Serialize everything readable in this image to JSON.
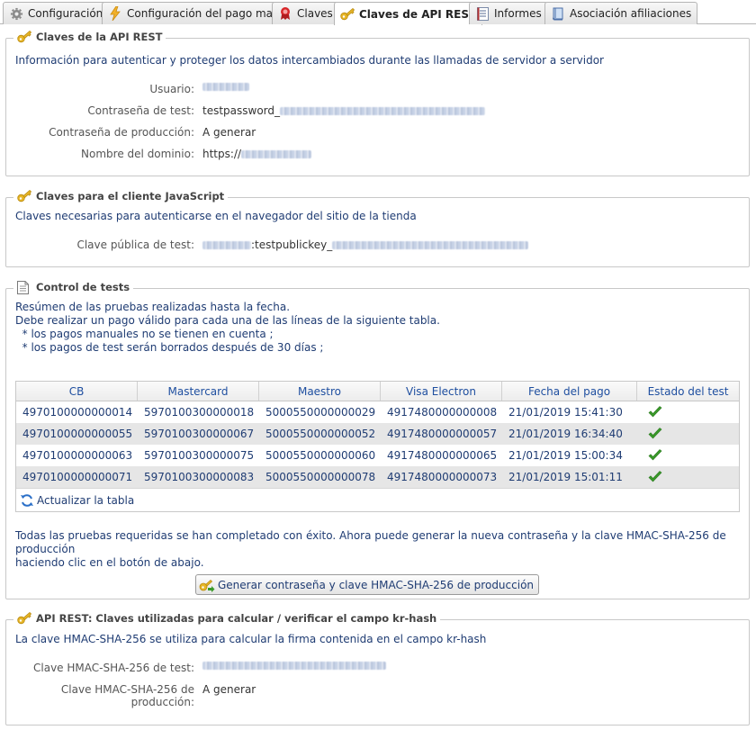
{
  "tabs": [
    {
      "label": "Configuración",
      "icon": "gear-icon"
    },
    {
      "label": "Configuración del pago manual",
      "icon": "lightning-icon"
    },
    {
      "label": "Claves",
      "icon": "badge-icon"
    },
    {
      "label": "Claves de API REST",
      "icon": "key-icon"
    },
    {
      "label": "Informes",
      "icon": "report-icon"
    },
    {
      "label": "Asociación afiliaciones",
      "icon": "book-icon"
    }
  ],
  "rest_keys": {
    "legend": "Claves de la API REST",
    "description": "Información para autenticar y proteger los datos intercambiados durante las llamadas de servidor a servidor",
    "user_label": "Usuario:",
    "test_password_label": "Contraseña de test:",
    "test_password_prefix": "testpassword_",
    "prod_password_label": "Contraseña de producción:",
    "prod_password_value": "A generar",
    "domain_label": "Nombre del dominio:",
    "domain_prefix": "https://"
  },
  "js_keys": {
    "legend": "Claves para el cliente JavaScript",
    "description": "Claves necesarias para autenticarse en el navegador del sitio de la tienda",
    "public_key_label": "Clave pública de test:",
    "public_key_middle": ":testpublickey_"
  },
  "tests": {
    "legend": "Control de tests",
    "intro": [
      "Resúmen de las pruebas realizadas hasta la fecha.",
      "Debe realizar un pago válido para cada una de las líneas de la siguiente tabla.",
      "  * los pagos manuales no se tienen en cuenta ;",
      "  * los pagos de test serán borrados después de 30 días ;"
    ],
    "columns": [
      "CB",
      "Mastercard",
      "Maestro",
      "Visa Electron",
      "Fecha del pago",
      "Estado del test"
    ],
    "rows": [
      [
        "4970100000000014",
        "5970100300000018",
        "5000550000000029",
        "4917480000000008",
        "21/01/2019 15:41:30"
      ],
      [
        "4970100000000055",
        "5970100300000067",
        "5000550000000052",
        "4917480000000057",
        "21/01/2019 16:34:40"
      ],
      [
        "4970100000000063",
        "5970100300000075",
        "5000550000000060",
        "4917480000000065",
        "21/01/2019 15:00:34"
      ],
      [
        "4970100000000071",
        "5970100300000083",
        "5000550000000078",
        "4917480000000073",
        "21/01/2019 15:01:11"
      ]
    ],
    "status_icon": "checkmark-icon",
    "refresh_label": "Actualizar la tabla",
    "success_text_1": "Todas las pruebas requeridas se han completado con éxito. Ahora puede generar la nueva contraseña y la clave HMAC-SHA-256 de producción",
    "success_text_2": "haciendo clic en el botón de abajo.",
    "generate_button": "Generar contraseña y clave HMAC-SHA-256 de producción"
  },
  "hmac": {
    "legend": "API REST: Claves utilizadas para calcular / verificar el campo kr-hash",
    "description": "La clave HMAC-SHA-256 se utiliza para calcular la firma contenida en el campo kr-hash",
    "test_label": "Clave HMAC-SHA-256 de test:",
    "prod_label_1": "Clave HMAC-SHA-256 de",
    "prod_label_2": "producción:",
    "prod_value": "A generar"
  },
  "colors": {
    "accent_text": "#1f3c73",
    "header_link": "#1f4fa0",
    "check_green": "#3a9a2a"
  }
}
